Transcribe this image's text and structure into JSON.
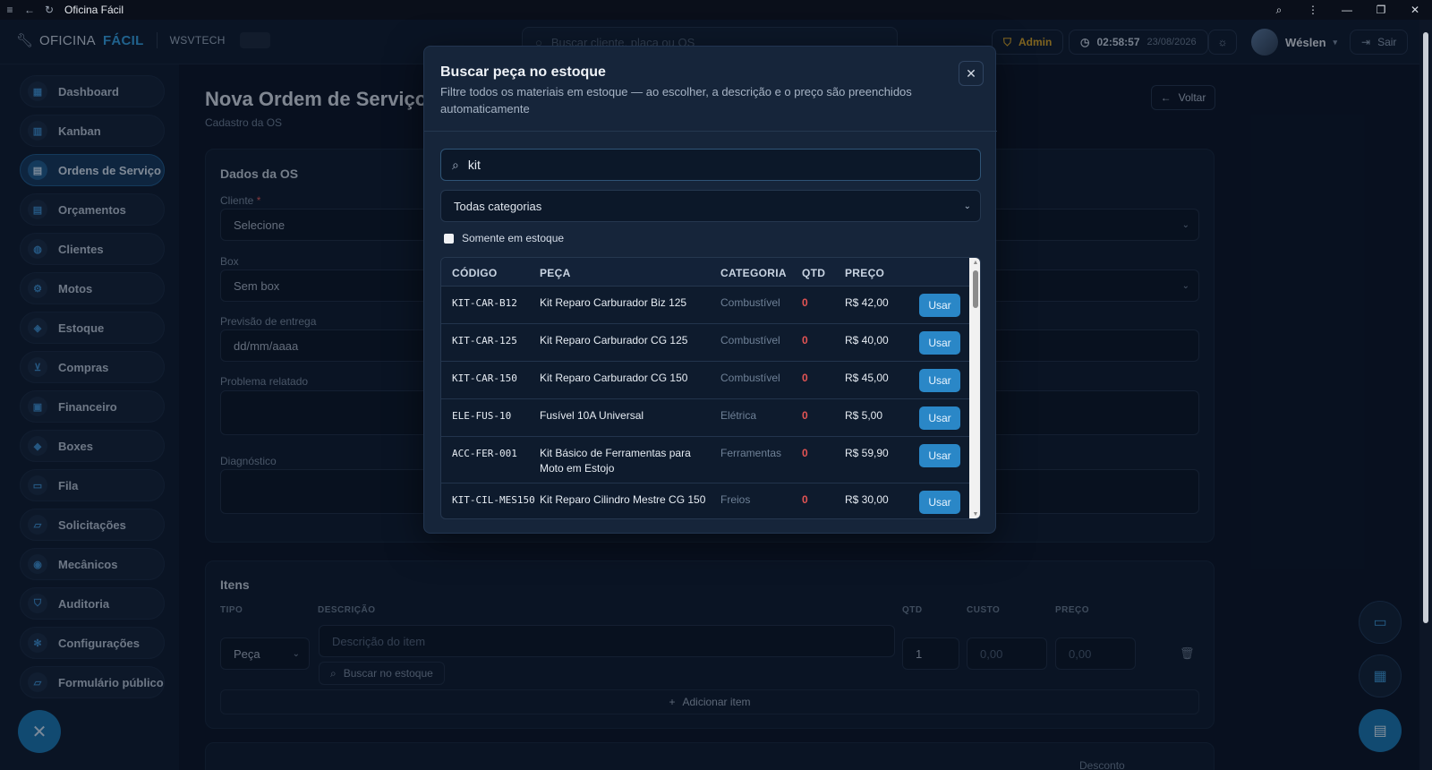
{
  "window": {
    "title": "Oficina Fácil"
  },
  "header": {
    "brand_main": "OFICINA",
    "brand_accent": "FÁCIL",
    "company": "WSVTECH",
    "search_placeholder": "Buscar cliente, placa ou OS",
    "role": "Admin",
    "time": "02:58:57",
    "date": "23/08/2026",
    "user": "Wéslen",
    "logout": "Sair"
  },
  "sidebar": {
    "items": [
      {
        "label": "Dashboard",
        "icon": "dashboard-icon"
      },
      {
        "label": "Kanban",
        "icon": "kanban-icon"
      },
      {
        "label": "Ordens de Serviço",
        "icon": "clipboard-icon",
        "active": true
      },
      {
        "label": "Orçamentos",
        "icon": "document-icon"
      },
      {
        "label": "Clientes",
        "icon": "users-icon"
      },
      {
        "label": "Motos",
        "icon": "bike-icon"
      },
      {
        "label": "Estoque",
        "icon": "box-icon"
      },
      {
        "label": "Compras",
        "icon": "cart-icon"
      },
      {
        "label": "Financeiro",
        "icon": "wallet-icon"
      },
      {
        "label": "Boxes",
        "icon": "boxes-icon"
      },
      {
        "label": "Fila",
        "icon": "ticket-icon"
      },
      {
        "label": "Solicitações",
        "icon": "inbox-icon"
      },
      {
        "label": "Mecânicos",
        "icon": "mechanic-icon"
      },
      {
        "label": "Auditoria",
        "icon": "shield-icon"
      },
      {
        "label": "Configurações",
        "icon": "gear-icon"
      },
      {
        "label": "Formulário público",
        "icon": "form-icon"
      }
    ]
  },
  "page": {
    "title": "Nova Ordem de Serviço",
    "subtitle": "Cadastro da OS",
    "back": "Voltar"
  },
  "os_form": {
    "title": "Dados da OS",
    "cliente_label": "Cliente",
    "cliente_req": "*",
    "cliente_value": "Selecione",
    "box_label": "Box",
    "box_value": "Sem box",
    "previsao_label": "Previsão de entrega",
    "previsao_placeholder": "dd/mm/aaaa",
    "problema_label": "Problema relatado",
    "diagnostico_label": "Diagnóstico"
  },
  "items": {
    "title": "Itens",
    "col_tipo": "TIPO",
    "col_descricao": "DESCRIÇÃO",
    "col_qtd": "QTD",
    "col_custo": "CUSTO",
    "col_preco": "PREÇO",
    "tipo_value": "Peça",
    "descricao_placeholder": "Descrição do item",
    "qtd_value": "1",
    "custo_placeholder": "0,00",
    "preco_placeholder": "0,00",
    "buscar_estoque": "Buscar no estoque",
    "adicionar": "Adicionar item"
  },
  "totals": {
    "desconto": "Desconto"
  },
  "modal": {
    "title": "Buscar peça no estoque",
    "description": "Filtre todos os materiais em estoque — ao escolher, a descrição e o preço são preenchidos automaticamente",
    "search_value": "kit",
    "category_value": "Todas categorias",
    "only_stock_label": "Somente em estoque",
    "only_stock_checked": false,
    "columns": [
      "CÓDIGO",
      "PEÇA",
      "CATEGORIA",
      "QTD",
      "PREÇO"
    ],
    "use_label": "Usar",
    "rows": [
      {
        "code": "KIT-CAR-B12",
        "name": "Kit Reparo Carburador Biz 125",
        "category": "Combustível",
        "qty": "0",
        "price": "R$ 42,00"
      },
      {
        "code": "KIT-CAR-125",
        "name": "Kit Reparo Carburador CG 125",
        "category": "Combustível",
        "qty": "0",
        "price": "R$ 40,00"
      },
      {
        "code": "KIT-CAR-150",
        "name": "Kit Reparo Carburador CG 150",
        "category": "Combustível",
        "qty": "0",
        "price": "R$ 45,00"
      },
      {
        "code": "ELE-FUS-10",
        "name": "Fusível 10A Universal",
        "category": "Elétrica",
        "qty": "0",
        "price": "R$ 5,00"
      },
      {
        "code": "ACC-FER-001",
        "name": "Kit Básico de Ferramentas para Moto em Estojo",
        "category": "Ferramentas",
        "qty": "0",
        "price": "R$ 59,90"
      },
      {
        "code": "KIT-CIL-MES150",
        "name": "Kit Reparo Cilindro Mestre CG 150",
        "category": "Freios",
        "qty": "0",
        "price": "R$ 30,00"
      }
    ]
  }
}
